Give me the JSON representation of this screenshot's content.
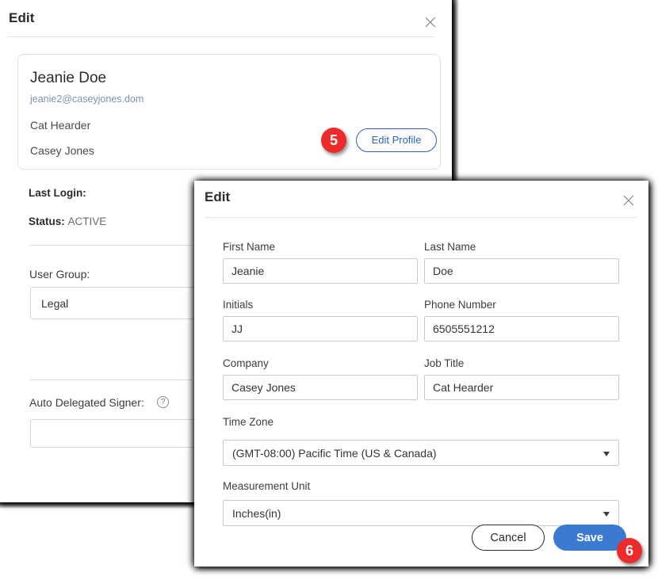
{
  "background_panel": {
    "title": "Edit",
    "close_icon": "close-icon",
    "profile_card": {
      "name": "Jeanie Doe",
      "email": "jeanie2@caseyjones.dom",
      "job_title": "Cat Hearder",
      "company": "Casey Jones",
      "edit_profile_label": "Edit Profile"
    },
    "details": {
      "last_login_label": "Last Login:",
      "last_login_value": "",
      "status_label": "Status:",
      "status_value": "ACTIVE",
      "user_group_label": "User Group:",
      "user_group_value": "Legal",
      "auto_delegated_signer_label": "Auto Delegated Signer:",
      "auto_delegated_signer_value": "",
      "help_icon_glyph": "?"
    }
  },
  "foreground_modal": {
    "title": "Edit",
    "close_icon": "close-icon",
    "fields": {
      "first_name_label": "First Name",
      "first_name_value": "Jeanie",
      "last_name_label": "Last Name",
      "last_name_value": "Doe",
      "initials_label": "Initials",
      "initials_value": "JJ",
      "phone_label": "Phone Number",
      "phone_value": "6505551212",
      "company_label": "Company",
      "company_value": "Casey Jones",
      "job_title_label": "Job Title",
      "job_title_value": "Cat Hearder",
      "time_zone_label": "Time Zone",
      "time_zone_value": "(GMT-08:00) Pacific Time (US & Canada)",
      "measurement_unit_label": "Measurement Unit",
      "measurement_unit_value": "Inches(in)"
    },
    "footer": {
      "cancel_label": "Cancel",
      "save_label": "Save"
    }
  },
  "callouts": {
    "five": "5",
    "six": "6"
  },
  "colors": {
    "accent_blue": "#3a7ad0",
    "link_blue": "#2a62b8",
    "callout_red": "#ed2b2b",
    "email_blue": "#7a93b8"
  }
}
